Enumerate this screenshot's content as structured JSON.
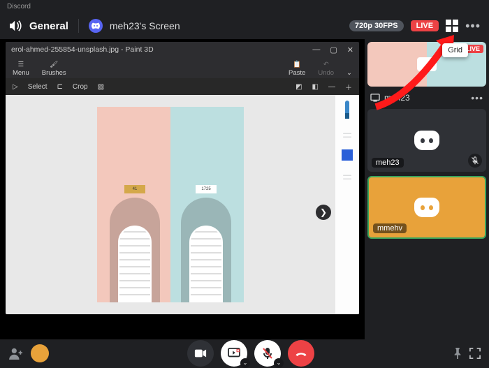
{
  "app": {
    "name": "Discord"
  },
  "header": {
    "channel": "General",
    "subtitle": "meh23's Screen",
    "quality": "720p 30FPS",
    "live": "LIVE",
    "tooltip": "Grid"
  },
  "paint3d": {
    "title": "erol-ahmed-255854-unsplash.jpg - Paint 3D",
    "menu": "Menu",
    "brushes": "Brushes",
    "paste": "Paste",
    "undo": "Undo",
    "select": "Select",
    "crop": "Crop",
    "plaque_left": "41",
    "plaque_right": "1725"
  },
  "sidebar": {
    "stream_user": "meh23",
    "live_badge": "LIVE",
    "tile1_label": "meh23",
    "tile2_label": "mmehv"
  },
  "icons": {
    "speaker": "speaker",
    "grid": "grid",
    "more": "•••"
  }
}
